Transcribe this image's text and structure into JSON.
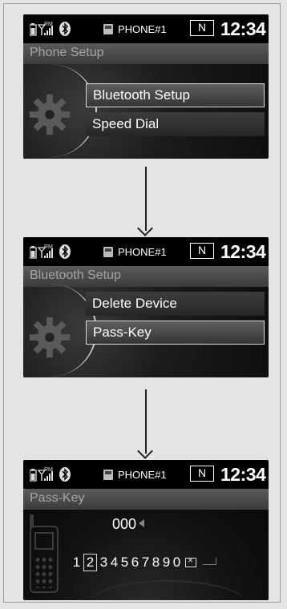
{
  "status": {
    "phone_label": "PHONE#1",
    "gear_indicator": "N",
    "time": "12:34"
  },
  "screens": [
    {
      "title": "Phone Setup",
      "items": [
        {
          "label": "Bluetooth Setup",
          "selected": true
        },
        {
          "label": "Speed Dial",
          "selected": false
        }
      ]
    },
    {
      "title": "Bluetooth Setup",
      "items": [
        {
          "label": "Delete Device",
          "selected": false
        },
        {
          "label": "Pass-Key",
          "selected": true
        }
      ]
    },
    {
      "title": "Pass-Key",
      "passkey_value": "000",
      "digits": [
        "1",
        "2",
        "3",
        "4",
        "5",
        "6",
        "7",
        "8",
        "9",
        "0"
      ],
      "selected_digit": "2"
    }
  ],
  "icons": [
    "battery-icon",
    "signal-icon",
    "roaming-icon",
    "bluetooth-icon",
    "phone-icon",
    "gear-icon",
    "arrow-down-icon",
    "handset-icon",
    "cursor-left-icon",
    "delete-icon",
    "enter-icon"
  ]
}
